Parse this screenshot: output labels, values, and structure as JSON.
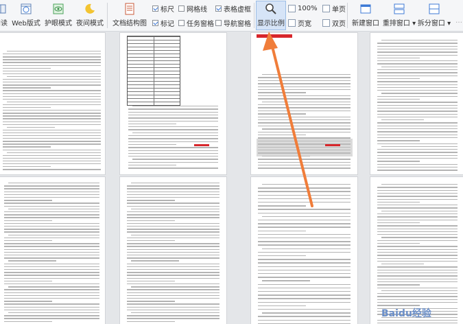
{
  "ribbon": {
    "buttons": [
      {
        "label": "阅读",
        "icon": "read-mode-icon"
      },
      {
        "label": "Web版式",
        "icon": "web-layout-icon"
      },
      {
        "label": "护眼模式",
        "icon": "eye-protect-icon"
      },
      {
        "label": "夜间模式",
        "icon": "night-mode-icon"
      },
      {
        "label": "文档结构图",
        "icon": "doc-structure-icon"
      },
      {
        "label": "显示比例",
        "icon": "zoom-magnifier-icon"
      },
      {
        "label": "新建窗口",
        "icon": "new-window-icon"
      },
      {
        "label": "重排窗口",
        "icon": "arrange-window-icon"
      },
      {
        "label": "拆分窗口",
        "icon": "split-window-icon"
      }
    ],
    "checkboxes": [
      {
        "label": "标尺",
        "checked": true
      },
      {
        "label": "网格线",
        "checked": false
      },
      {
        "label": "表格虚框",
        "checked": true
      },
      {
        "label": "标记",
        "checked": true
      },
      {
        "label": "任务窗格",
        "checked": false
      },
      {
        "label": "导航窗格",
        "checked": false
      }
    ],
    "zoom_value": "100%",
    "single_page": "单页",
    "page_width": "页宽",
    "two_pages": "双页"
  },
  "watermark": "Baidu经验",
  "colors": {
    "ribbon_bg": "#f5f6f8",
    "accent": "#2f6fd6",
    "arrow": "#f07d3a",
    "highlight": "#d6e4f7"
  }
}
